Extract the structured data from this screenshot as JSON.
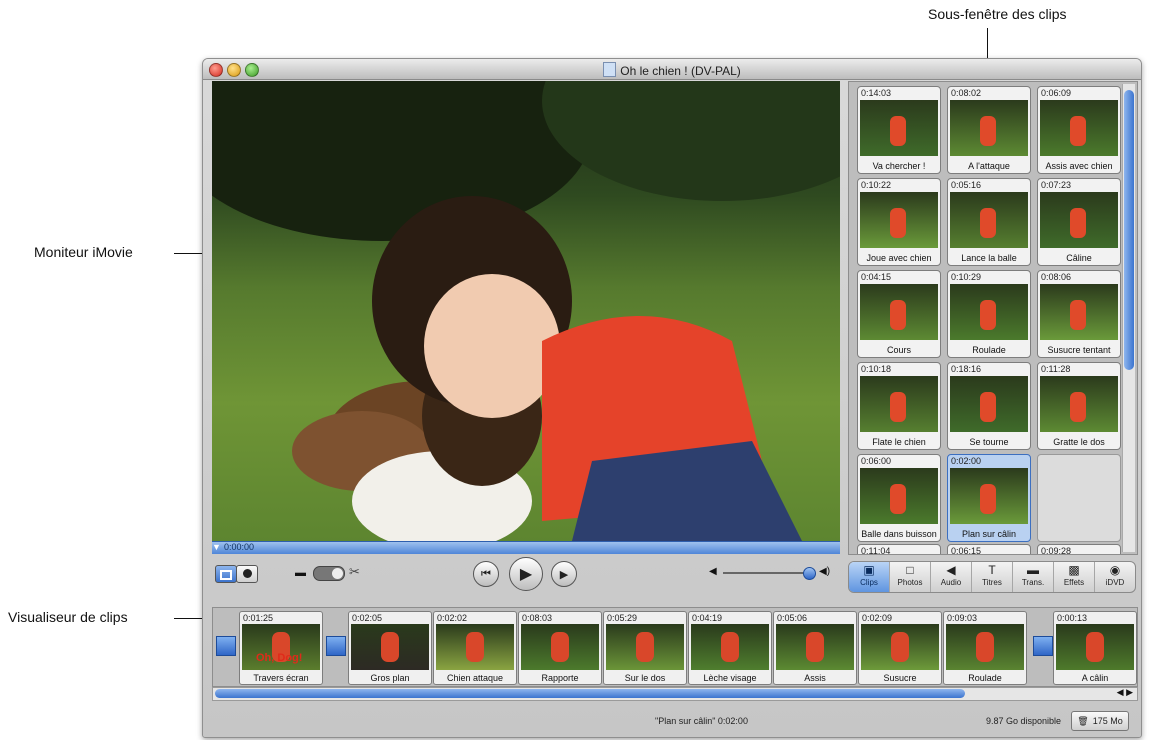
{
  "callouts": {
    "clips_pane": "Sous-fenêtre des clips",
    "monitor": "Moniteur iMovie",
    "clip_viewer": "Visualiseur de clips"
  },
  "window": {
    "title": "Oh le chien ! (DV-PAL)"
  },
  "monitor": {
    "playhead_time": "0:00:00"
  },
  "clips_pane": {
    "clips": [
      {
        "duration": "0:14:03",
        "name": "Va chercher !"
      },
      {
        "duration": "0:08:02",
        "name": "A l'attaque"
      },
      {
        "duration": "0:06:09",
        "name": "Assis avec chien"
      },
      {
        "duration": "0:10:22",
        "name": "Joue avec chien"
      },
      {
        "duration": "0:05:16",
        "name": "Lance la balle"
      },
      {
        "duration": "0:07:23",
        "name": "Câline"
      },
      {
        "duration": "0:04:15",
        "name": "Cours"
      },
      {
        "duration": "0:10:29",
        "name": "Roulade"
      },
      {
        "duration": "0:08:06",
        "name": "Susucre tentant"
      },
      {
        "duration": "0:10:18",
        "name": "Flate le chien"
      },
      {
        "duration": "0:18:16",
        "name": "Se tourne"
      },
      {
        "duration": "0:11:28",
        "name": "Gratte le dos"
      },
      {
        "duration": "0:06:00",
        "name": "Balle dans buisson"
      },
      {
        "duration": "0:02:00",
        "name": "Plan sur câlin",
        "selected": true
      }
    ],
    "partial_row": [
      "0:11:04",
      "0:06:15",
      "0:09:28"
    ]
  },
  "pane_tabs": [
    {
      "label": "Clips",
      "icon": "clips-icon",
      "glyph": "▣",
      "active": true
    },
    {
      "label": "Photos",
      "icon": "photos-icon",
      "glyph": "□"
    },
    {
      "label": "Audio",
      "icon": "audio-icon",
      "glyph": "◀"
    },
    {
      "label": "Titres",
      "icon": "titles-icon",
      "glyph": "T"
    },
    {
      "label": "Trans.",
      "icon": "transitions-icon",
      "glyph": "▬"
    },
    {
      "label": "Effets",
      "icon": "effects-icon",
      "glyph": "▩"
    },
    {
      "label": "iDVD",
      "icon": "idvd-icon",
      "glyph": "◉"
    }
  ],
  "clip_viewer": {
    "clips": [
      {
        "duration": "0:01:25",
        "name": "Travers écran",
        "title_overlay": "Oh, Dog!"
      },
      {
        "duration": "0:02:05",
        "name": "Gros plan"
      },
      {
        "duration": "0:02:02",
        "name": "Chien attaque"
      },
      {
        "duration": "0:08:03",
        "name": "Rapporte"
      },
      {
        "duration": "0:05:29",
        "name": "Sur le dos"
      },
      {
        "duration": "0:04:19",
        "name": "Lèche visage"
      },
      {
        "duration": "0:05:06",
        "name": "Assis"
      },
      {
        "duration": "0:02:09",
        "name": "Susucre"
      },
      {
        "duration": "0:09:03",
        "name": "Roulade"
      },
      {
        "duration": "0:00:13",
        "name": "A câlin"
      }
    ]
  },
  "status": {
    "selected_clip": "\"Plan sur câlin\"  0:02:00",
    "disk_free": "9.87 Go disponible",
    "trash_size": "175 Mo"
  },
  "colors": {
    "accent": "#3b74cf",
    "selected_clip": "#b9d1f1"
  }
}
